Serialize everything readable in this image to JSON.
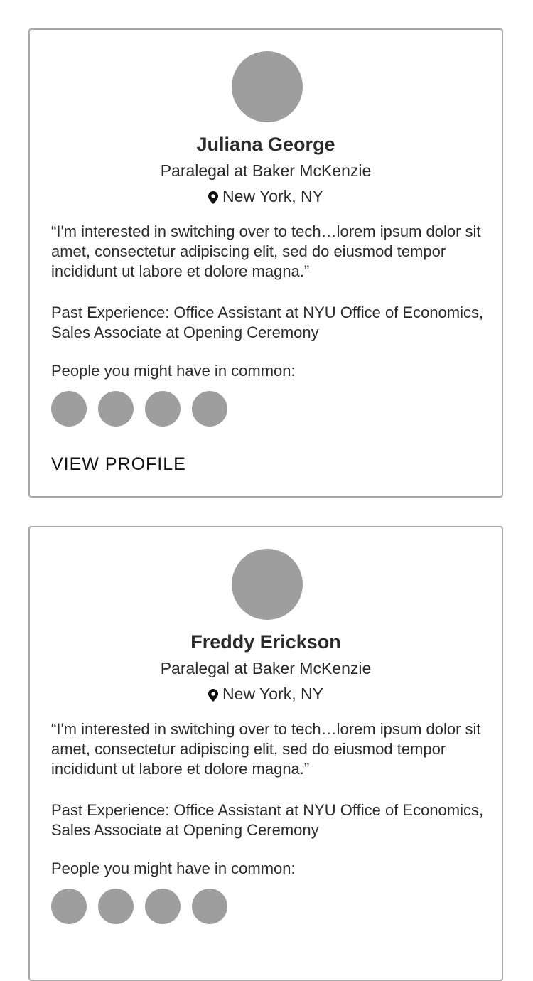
{
  "profiles": [
    {
      "name": "Juliana George",
      "title": "Paralegal at Baker McKenzie",
      "location": "New York, NY",
      "quote": "“I'm interested in switching over to tech…lorem ipsum dolor sit amet, consectetur adipiscing elit, sed do eiusmod tempor incididunt ut labore et dolore magna.”",
      "experience": "Past Experience: Office Assistant at NYU Office of Economics, Sales Associate at Opening Ceremony",
      "common_label": "People you might have in common:",
      "common_count": 4,
      "action_label": "VIEW PROFILE"
    },
    {
      "name": "Freddy Erickson",
      "title": "Paralegal at Baker McKenzie",
      "location": "New York, NY",
      "quote": "“I'm interested in switching over to tech…lorem ipsum dolor sit amet, consectetur adipiscing elit, sed do eiusmod tempor incididunt ut labore et dolore magna.”",
      "experience": "Past Experience: Office Assistant at NYU Office of Economics, Sales Associate at Opening Ceremony",
      "common_label": "People you might have in common:",
      "common_count": 4
    }
  ],
  "icons": {
    "location": "map-pin-icon"
  },
  "colors": {
    "avatar_placeholder": "#9e9e9e",
    "card_border": "#a8a8a8",
    "text": "#2b2b2b"
  }
}
